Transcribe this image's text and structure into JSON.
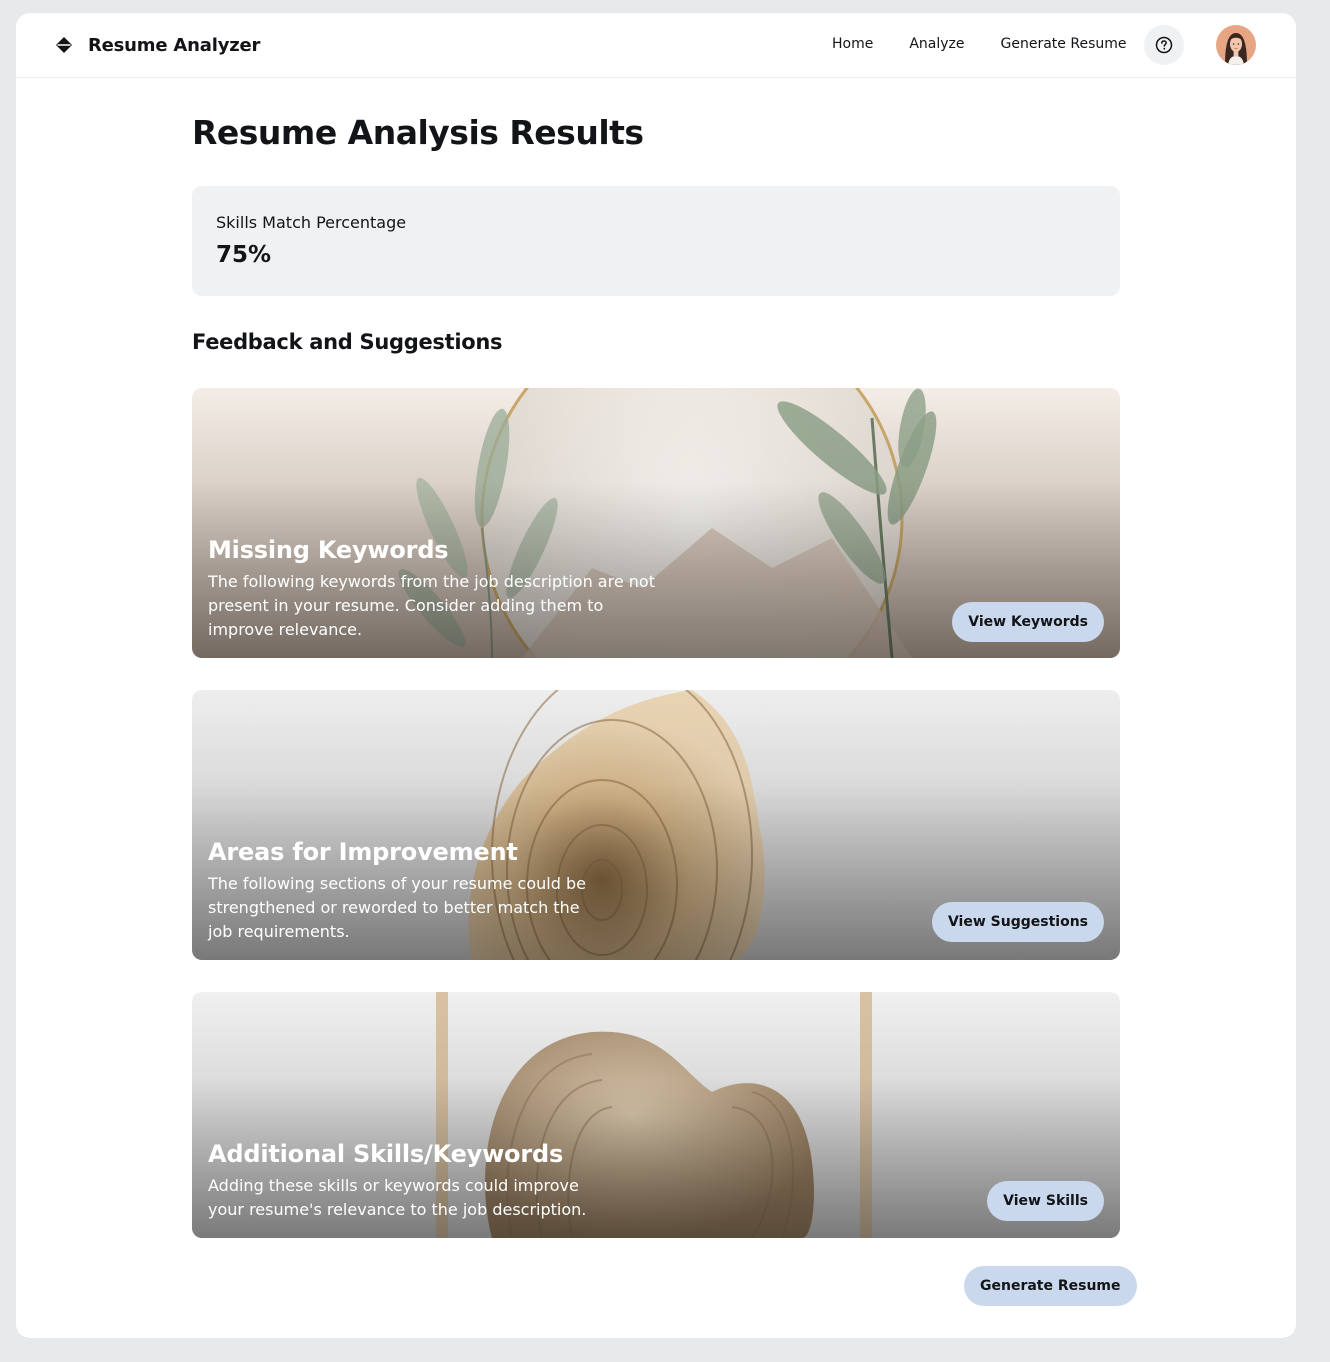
{
  "header": {
    "brand": "Resume Analyzer",
    "nav": [
      "Home",
      "Analyze",
      "Generate Resume"
    ]
  },
  "main": {
    "title": "Resume Analysis Results",
    "stat": {
      "label": "Skills Match Percentage",
      "value": "75%"
    },
    "feedback_title": "Feedback and Suggestions",
    "cards": [
      {
        "title": "Missing Keywords",
        "description": "The following keywords from the job description are not present in your resume. Consider adding them to improve relevance.",
        "button": "View Keywords"
      },
      {
        "title": "Areas for Improvement",
        "description": "The following sections of your resume could be strengthened or reworded to better match the job requirements.",
        "button": "View Suggestions"
      },
      {
        "title": "Additional Skills/Keywords",
        "description": "Adding these skills or keywords could improve your resume's relevance to the job description.",
        "button": "View Skills"
      }
    ],
    "generate_button": "Generate Resume"
  },
  "colors": {
    "accent_button": "#c9d8ec",
    "stat_card": "#f0f1f3",
    "text": "#121417"
  },
  "icons": {
    "brand": "diamond-logo-icon",
    "help": "question-circle-icon",
    "avatar": "user-avatar"
  }
}
